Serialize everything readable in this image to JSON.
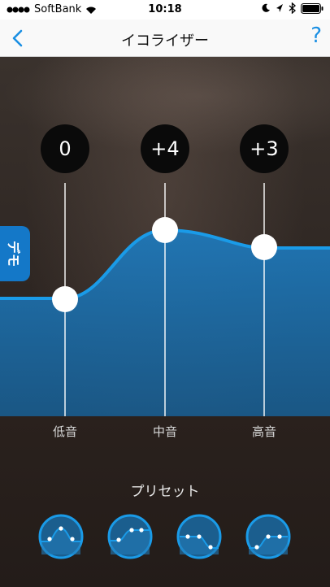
{
  "status": {
    "carrier": "SoftBank",
    "time": "10:18"
  },
  "nav": {
    "title": "イコライザー",
    "help": "?"
  },
  "demo": {
    "label": "デモ"
  },
  "bands": [
    {
      "label": "低音",
      "value": "+0",
      "display": "0"
    },
    {
      "label": "中音",
      "value": "+4",
      "display": "+4"
    },
    {
      "label": "高音",
      "value": "+3",
      "display": "+3"
    }
  ],
  "presets": {
    "title": "プリセット",
    "items": [
      "preset-1",
      "preset-2",
      "preset-3",
      "preset-4"
    ]
  },
  "colors": {
    "accent": "#1a8fe3",
    "fill": "#1c6da8",
    "handle": "#ffffff",
    "nav_bg": "#f9f9f9"
  }
}
